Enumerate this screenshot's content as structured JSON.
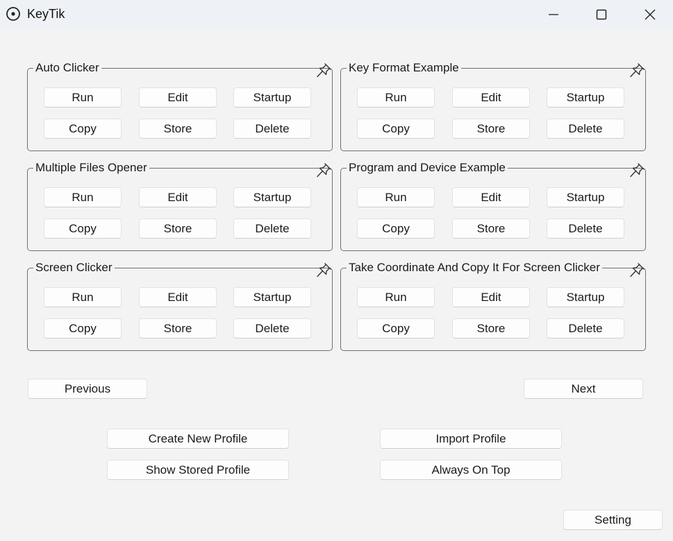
{
  "window": {
    "title": "KeyTik"
  },
  "profiles": [
    {
      "name": "Auto Clicker",
      "buttons": {
        "run": "Run",
        "edit": "Edit",
        "startup": "Startup",
        "copy": "Copy",
        "store": "Store",
        "delete": "Delete"
      }
    },
    {
      "name": "Key Format Example",
      "buttons": {
        "run": "Run",
        "edit": "Edit",
        "startup": "Startup",
        "copy": "Copy",
        "store": "Store",
        "delete": "Delete"
      }
    },
    {
      "name": "Multiple Files Opener",
      "buttons": {
        "run": "Run",
        "edit": "Edit",
        "startup": "Startup",
        "copy": "Copy",
        "store": "Store",
        "delete": "Delete"
      }
    },
    {
      "name": "Program and Device Example",
      "buttons": {
        "run": "Run",
        "edit": "Edit",
        "startup": "Startup",
        "copy": "Copy",
        "store": "Store",
        "delete": "Delete"
      }
    },
    {
      "name": "Screen Clicker",
      "buttons": {
        "run": "Run",
        "edit": "Edit",
        "startup": "Startup",
        "copy": "Copy",
        "store": "Store",
        "delete": "Delete"
      }
    },
    {
      "name": "Take Coordinate And Copy It For Screen Clicker",
      "buttons": {
        "run": "Run",
        "edit": "Edit",
        "startup": "Startup",
        "copy": "Copy",
        "store": "Store",
        "delete": "Delete"
      }
    }
  ],
  "pagination": {
    "previous": "Previous",
    "next": "Next"
  },
  "actions": {
    "create_new_profile": "Create New Profile",
    "import_profile": "Import Profile",
    "show_stored_profile": "Show Stored Profile",
    "always_on_top": "Always On Top",
    "setting": "Setting"
  },
  "icons": {
    "app": "target-circle-icon",
    "pin": "pin-icon",
    "minimize": "minimize-icon",
    "maximize": "maximize-icon",
    "close": "close-icon"
  }
}
